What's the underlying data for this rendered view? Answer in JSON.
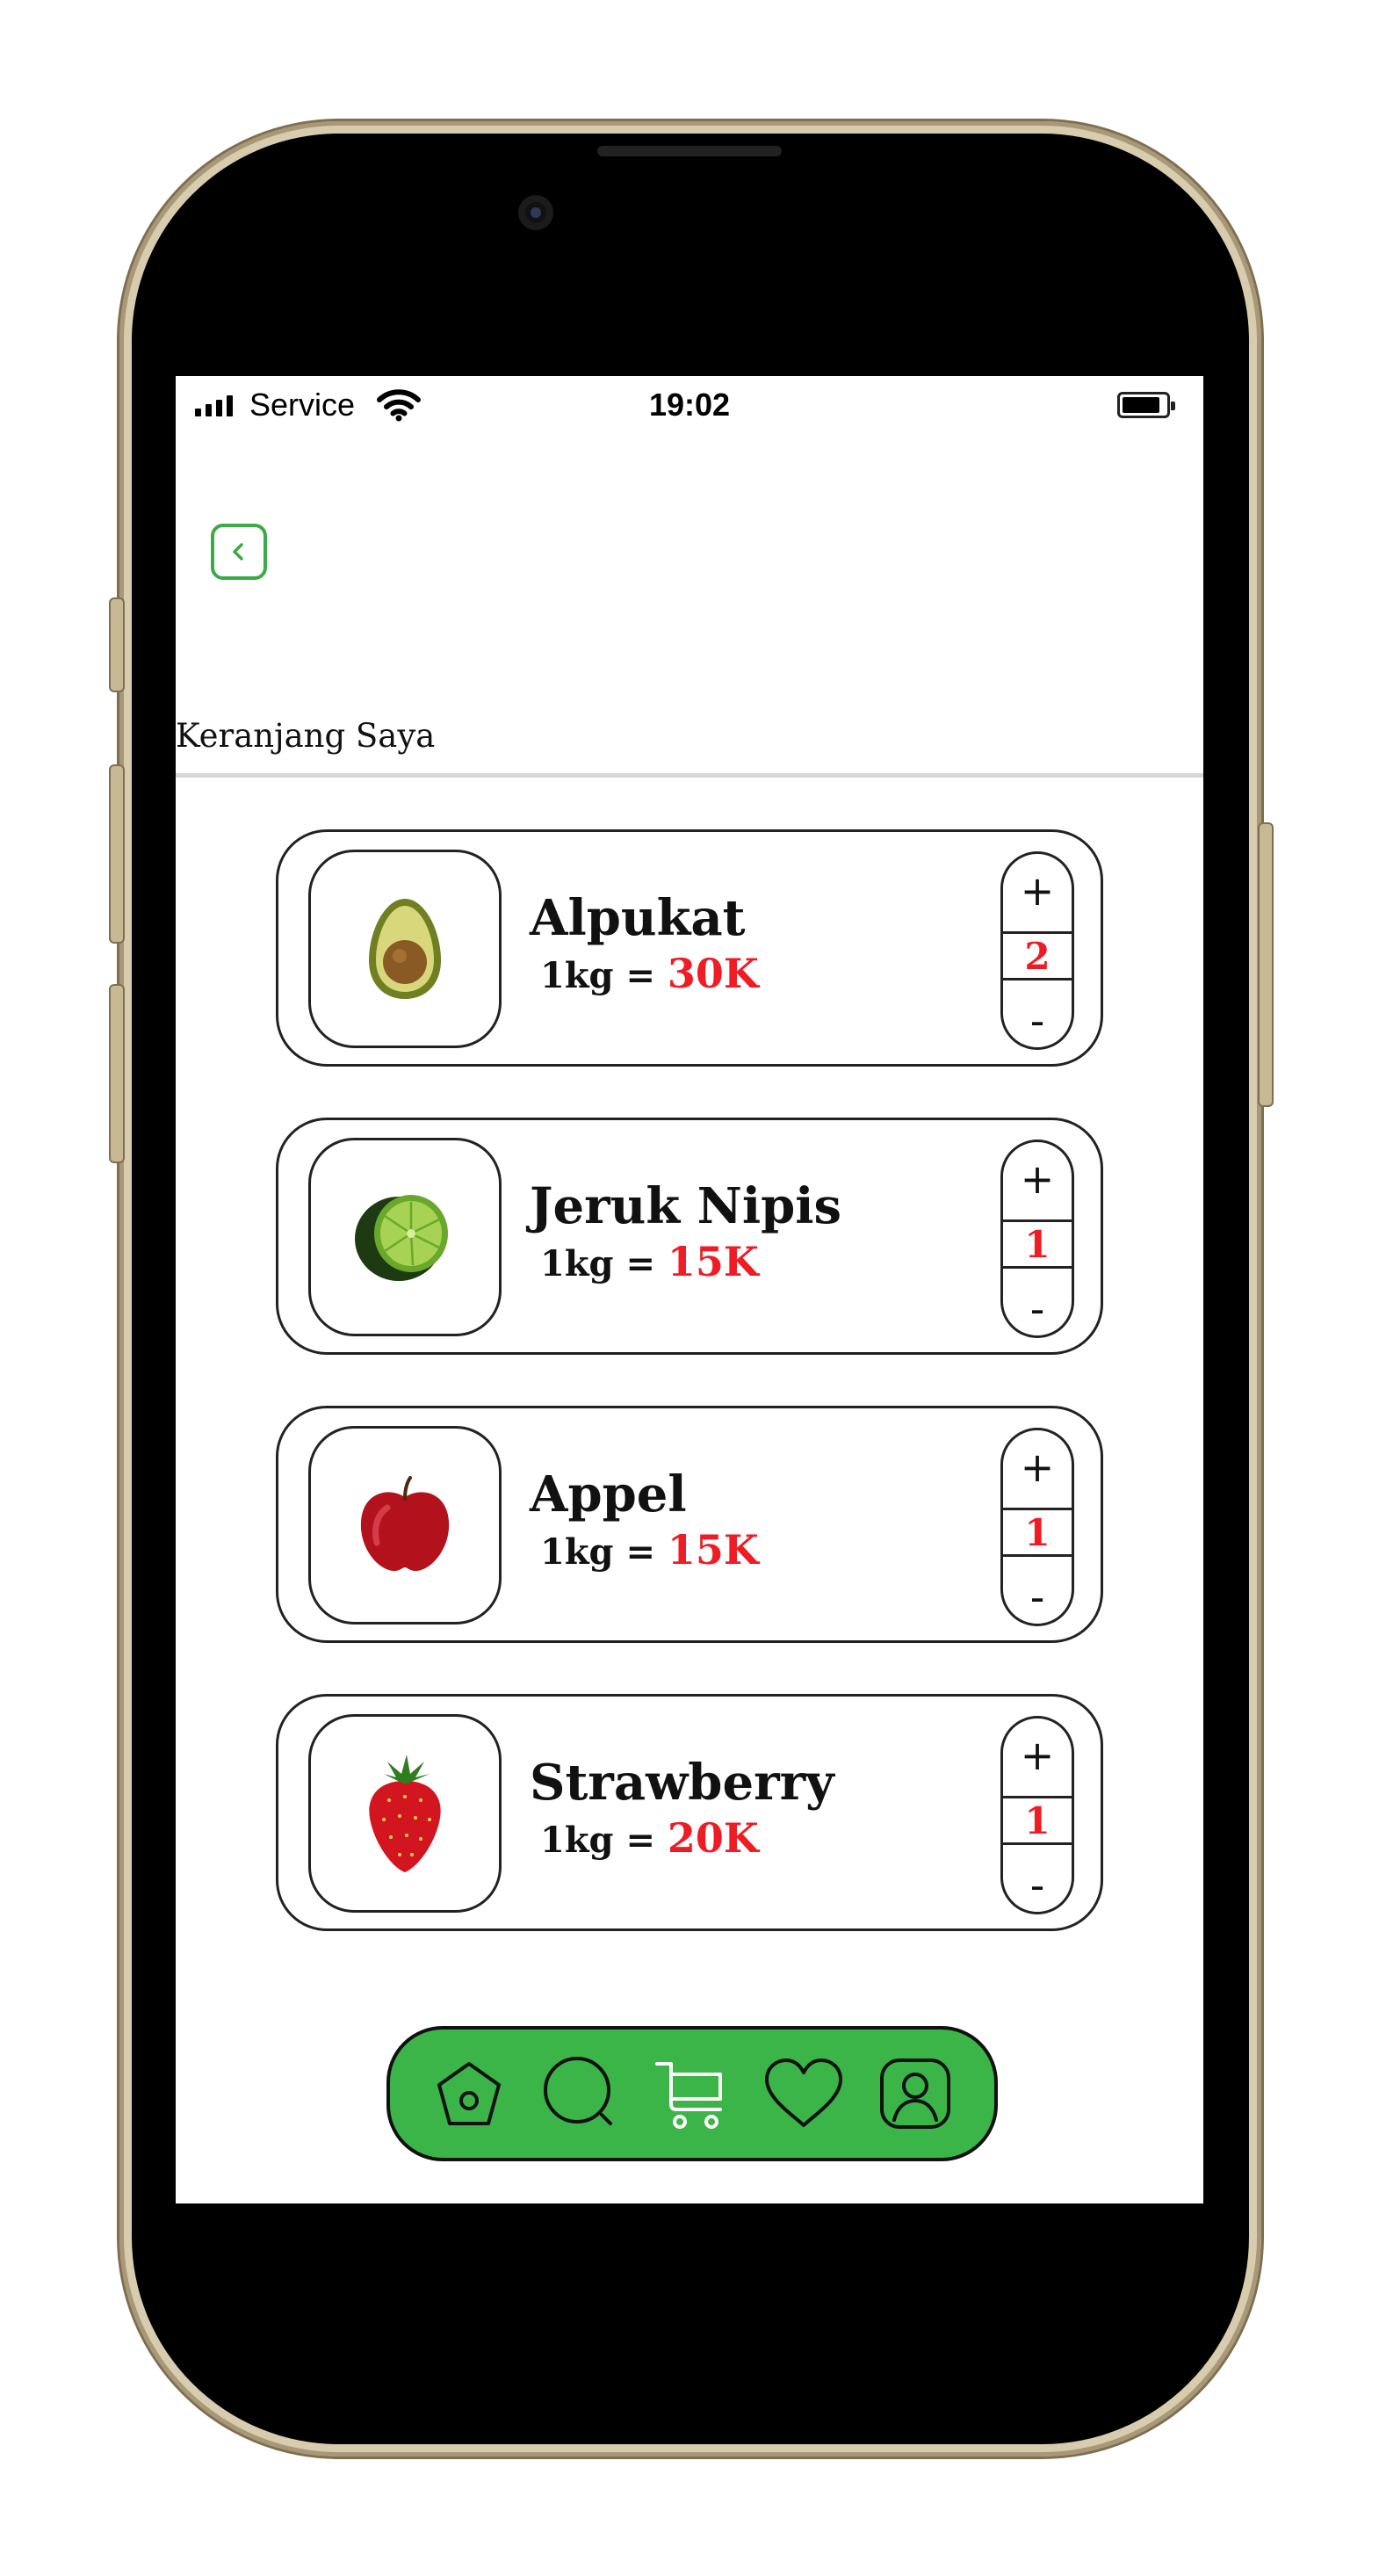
{
  "status_bar": {
    "carrier": "Service",
    "time": "19:02",
    "icons": [
      "signal-icon",
      "wifi-icon",
      "battery-icon"
    ]
  },
  "header": {
    "back_icon": "chevron-left-icon",
    "title": "Keranjang Saya"
  },
  "cart": {
    "items": [
      {
        "name": "Alpukat",
        "unit": "1kg = ",
        "price": "30K",
        "quantity": "2",
        "image": "avocado-image"
      },
      {
        "name": "Jeruk Nipis",
        "unit": "1kg = ",
        "price": "15K",
        "quantity": "1",
        "image": "lime-image"
      },
      {
        "name": "Appel",
        "unit": "1kg = ",
        "price": "15K",
        "quantity": "1",
        "image": "apple-image"
      },
      {
        "name": "Strawberry",
        "unit": "1kg = ",
        "price": "20K",
        "quantity": "1",
        "image": "strawberry-image"
      }
    ],
    "increment_label": "+",
    "decrement_label": "-"
  },
  "nav": {
    "items": [
      "home-icon",
      "search-icon",
      "cart-icon",
      "heart-icon",
      "profile-icon"
    ],
    "active": "cart-icon"
  },
  "colors": {
    "accent_green": "#3bb448",
    "price_red": "#ee1c25"
  }
}
